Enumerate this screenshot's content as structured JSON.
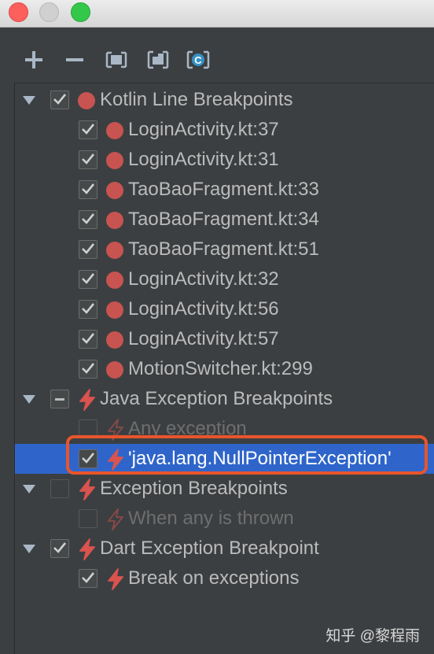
{
  "toolbar": {
    "buttons": [
      {
        "icon": "plus-icon"
      },
      {
        "icon": "minus-icon"
      },
      {
        "icon": "group-by-file-icon"
      },
      {
        "icon": "group-by-package-icon"
      },
      {
        "icon": "group-by-class-icon",
        "glyph": "C"
      }
    ]
  },
  "groups": [
    {
      "label": "Kotlin Line Breakpoints",
      "state": "checked",
      "type": "line",
      "items": [
        {
          "label": "LoginActivity.kt:37",
          "checked": true
        },
        {
          "label": "LoginActivity.kt:31",
          "checked": true
        },
        {
          "label": "TaoBaoFragment.kt:33",
          "checked": true
        },
        {
          "label": "TaoBaoFragment.kt:34",
          "checked": true
        },
        {
          "label": "TaoBaoFragment.kt:51",
          "checked": true
        },
        {
          "label": "LoginActivity.kt:32",
          "checked": true
        },
        {
          "label": "LoginActivity.kt:56",
          "checked": true
        },
        {
          "label": "LoginActivity.kt:57",
          "checked": true
        },
        {
          "label": "MotionSwitcher.kt:299",
          "checked": true
        }
      ]
    },
    {
      "label": "Java Exception Breakpoints",
      "state": "partial",
      "type": "exception",
      "items": [
        {
          "label": "Any exception",
          "checked": false
        },
        {
          "label": "'java.lang.NullPointerException'",
          "checked": true,
          "selected": true
        }
      ]
    },
    {
      "label": "Exception Breakpoints",
      "state": "unchecked",
      "type": "exception",
      "items": [
        {
          "label": "When any is thrown",
          "checked": false
        }
      ]
    },
    {
      "label": "Dart Exception Breakpoint",
      "state": "checked",
      "type": "exception",
      "items": [
        {
          "label": "Break on exceptions",
          "checked": true
        }
      ]
    }
  ],
  "watermark": "知乎 @黎程雨",
  "colors": {
    "background": "#3c3f41",
    "selection": "#2f65ca",
    "highlight_border": "#e8552c",
    "breakpoint_dot": "#c75450",
    "exception_bolt": "#d9534f"
  }
}
